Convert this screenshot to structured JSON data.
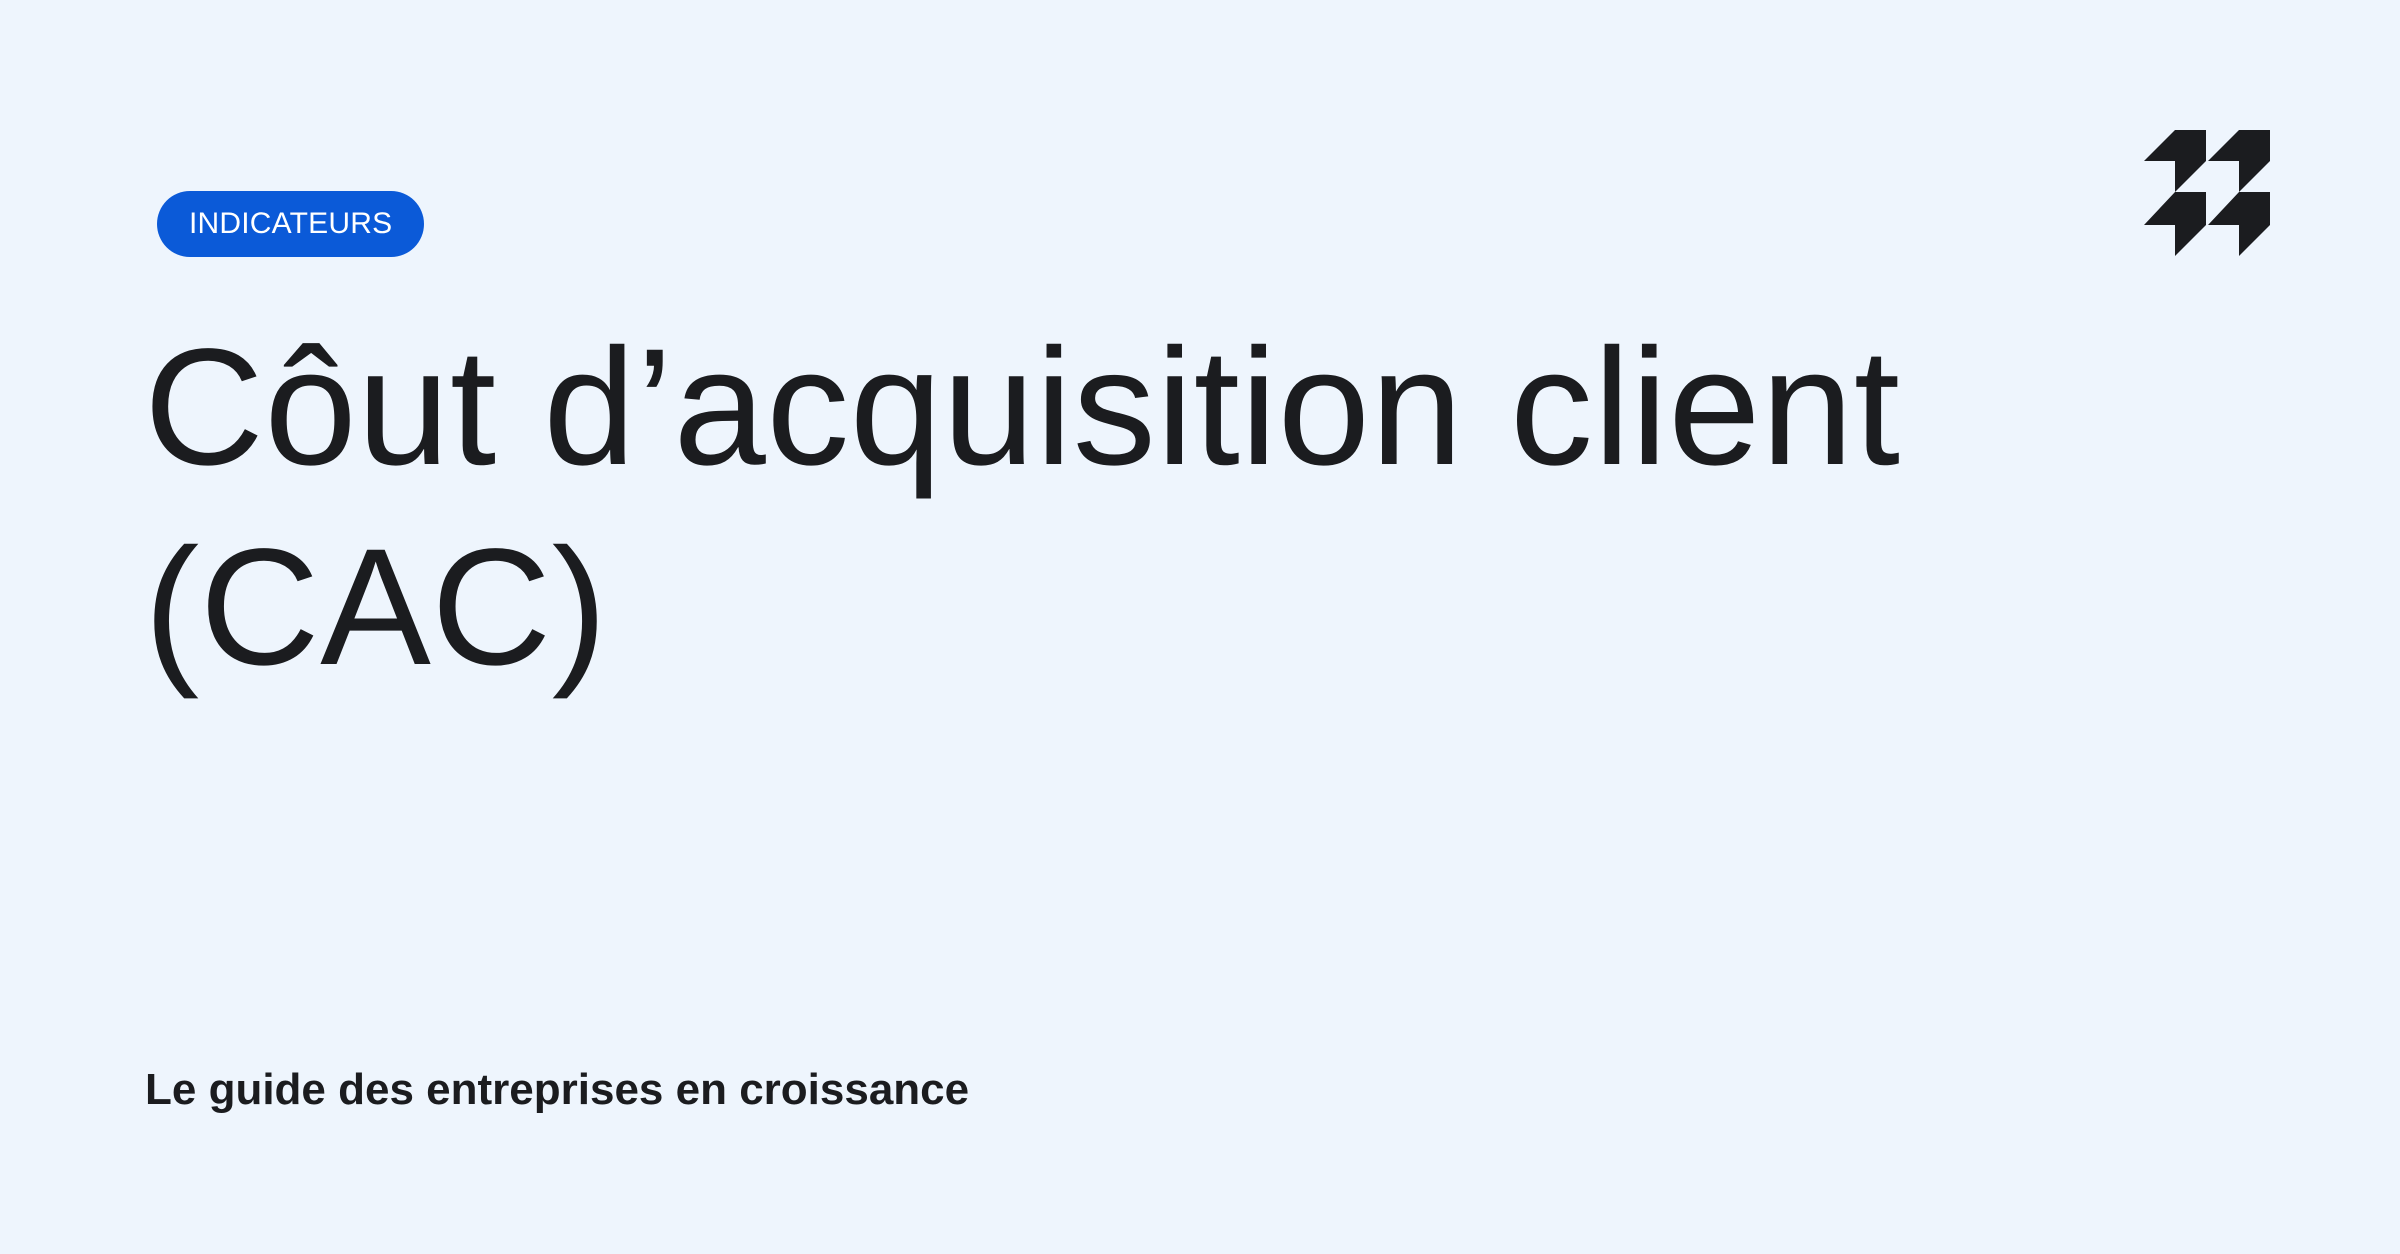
{
  "badge": {
    "label": "INDICATEURS",
    "color": "#0b5ad8"
  },
  "title": "Côut d’acquisition client (CAC)",
  "subtitle": "Le guide des entreprises en croissance",
  "logo": {
    "icon": "brand-quote-mark-icon",
    "color": "#1b1c1f"
  },
  "colors": {
    "background": "#eef5fd",
    "text": "#1b1c1f"
  }
}
